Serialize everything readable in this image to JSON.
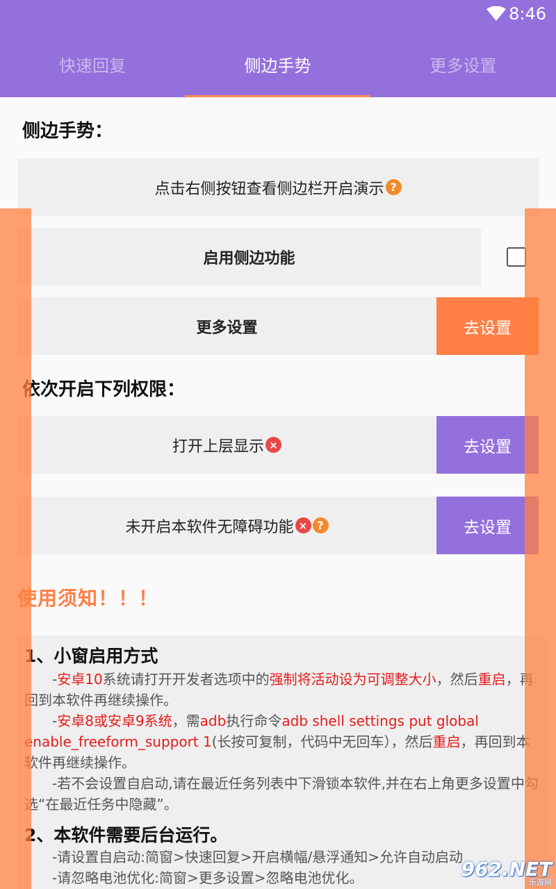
{
  "status_bar": {
    "time": "8:46"
  },
  "tabs": [
    {
      "label": "快速回复",
      "active": false
    },
    {
      "label": "侧边手势",
      "active": true
    },
    {
      "label": "更多设置",
      "active": false
    }
  ],
  "colors": {
    "primary": "#9470dc",
    "accent": "#ff7f47",
    "red_text": "#e41c1c"
  },
  "section_side_gesture": {
    "title": "侧边手势：",
    "demo_hint": "点击右侧按钮查看侧边栏开启演示",
    "enable_label": "启用侧边功能",
    "enable_checked": false,
    "more_settings_label": "更多设置",
    "more_settings_button": "去设置"
  },
  "section_permissions": {
    "title": "依次开启下列权限：",
    "items": [
      {
        "label": "打开上层显示",
        "button": "去设置"
      },
      {
        "label": "未开启本软件无障碍功能",
        "button": "去设置"
      }
    ]
  },
  "notice": {
    "title": "使用须知！！！",
    "s1_title": "1、小窗启用方式",
    "p1": [
      "-",
      "安卓10",
      "系统请打开开发者选项中的",
      "强制将活动设为可调整大小",
      "，然后",
      "重启",
      "，再回到本软件再继续操作。"
    ],
    "p2": [
      "-",
      "安卓8或安卓9系统",
      "，需",
      "adb",
      "执行命令",
      "adb shell settings put global enable_freeform_support 1",
      "(长按可复制，代码中无回车），然后",
      "重启",
      "，再回到本软件再继续操作。"
    ],
    "p3": "-若不会设置自启动,请在最近任务列表中下滑锁本软件,并在右上角更多设置中勾选“在最近任务中隐藏”。",
    "s2_title": "2、本软件需要后台运行。",
    "p4": "-请设置自启动:简窗>快速回复>开启横幅/悬浮通知>允许自动启动",
    "p5": "-请忽略电池优化:简窗>更多设置>忽略电池优化。"
  },
  "watermark": {
    "main": "962.NET",
    "sub": "乐游网"
  }
}
